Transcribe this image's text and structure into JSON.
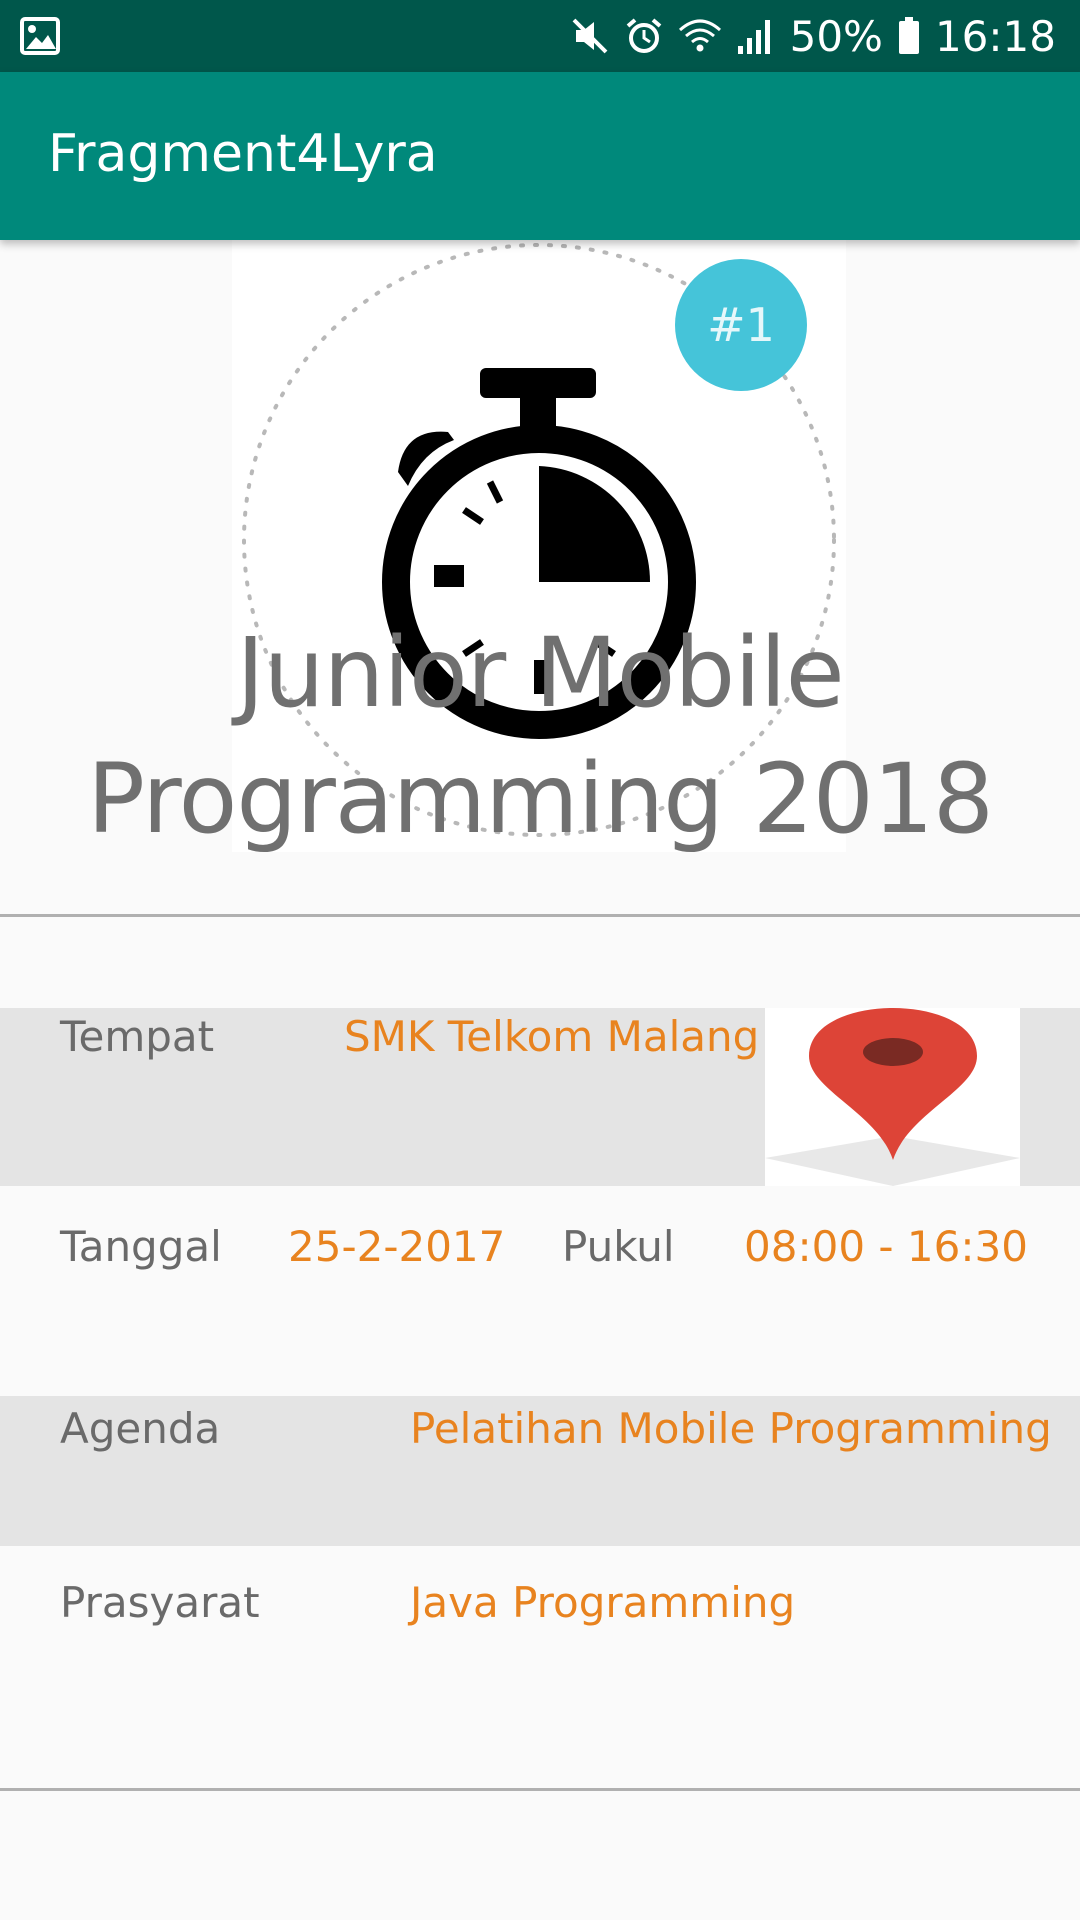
{
  "status_bar": {
    "battery_percent": "50%",
    "time": "16:18",
    "icons": [
      "gallery-icon",
      "mute-icon",
      "alarm-icon",
      "wifi-icon",
      "signal-icon",
      "battery-icon"
    ]
  },
  "app_bar": {
    "title": "Fragment4Lyra"
  },
  "hero": {
    "badge": "#1",
    "title_line1": "Junior Mobile",
    "title_line2": "Programming 2018",
    "icon": "stopwatch-icon"
  },
  "details": {
    "tempat": {
      "label": "Tempat",
      "value": "SMK Telkom Malang",
      "icon": "map-pin-icon"
    },
    "tanggal": {
      "label": "Tanggal",
      "value": "25-2-2017"
    },
    "pukul": {
      "label": "Pukul",
      "value": "08:00 - 16:30"
    },
    "agenda": {
      "label": "Agenda",
      "value": "Pelatihan Mobile Programming"
    },
    "prasyarat": {
      "label": "Prasyarat",
      "value": "Java Programming"
    }
  },
  "colors": {
    "status_bar": "#00574b",
    "app_bar": "#00897b",
    "label_text": "#6a6a6a",
    "value_text": "#e8831f",
    "row_shade": "#e4e4e4",
    "badge": "#45c4d9",
    "pin": "#dd4437"
  }
}
